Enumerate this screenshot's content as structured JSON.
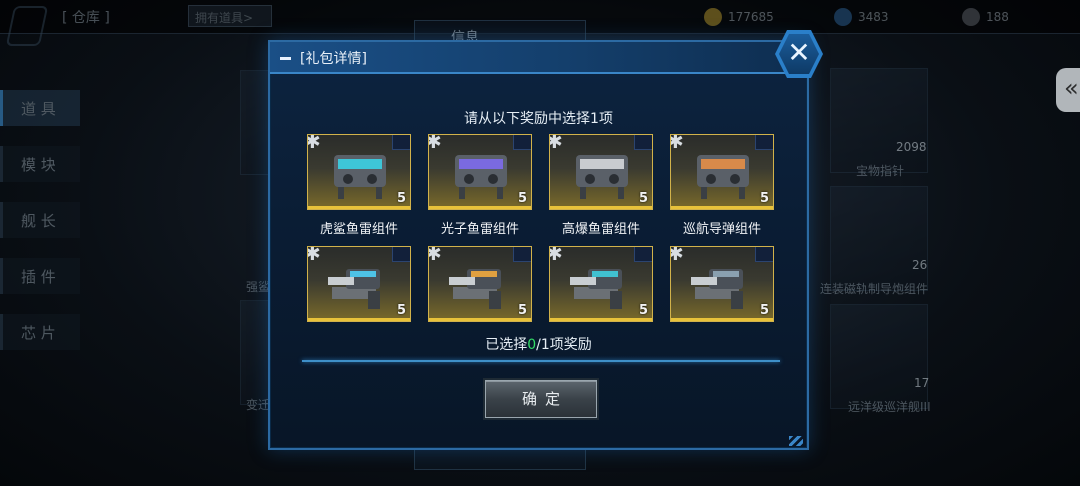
{
  "background": {
    "title": "[ 仓库 ]",
    "top_button": "拥有道具>",
    "resources": [
      {
        "value": "177685",
        "color": "#a58a2a"
      },
      {
        "value": "3483",
        "color": "#2a5a8a"
      },
      {
        "value": "188",
        "color": "#555a60"
      }
    ],
    "sidebar_tabs": [
      "道 具",
      "模 块",
      "舰 长",
      "插 件",
      "芯 片"
    ],
    "panel_title": "信息",
    "right_cards": [
      {
        "label": "宝物指针",
        "count": "2098"
      },
      {
        "label": "连装磁轨制导炮组件",
        "count": "26"
      },
      {
        "label": "远洋级巡洋舰III",
        "count": "17"
      }
    ],
    "left_card_label": "强鲨",
    "left_card_label2": "变迁"
  },
  "modal": {
    "title": "[礼包详情]",
    "instruction": "请从以下奖励中选择1项",
    "items": [
      {
        "label": "虎鲨鱼雷组件",
        "count": "5",
        "icon": "torpedo-launcher-icon",
        "accent": "#3ec6d8"
      },
      {
        "label": "光子鱼雷组件",
        "count": "5",
        "icon": "photon-torpedo-icon",
        "accent": "#7a6ae0"
      },
      {
        "label": "高爆鱼雷组件",
        "count": "5",
        "icon": "high-explosive-torpedo-icon",
        "accent": "#c9ccd0"
      },
      {
        "label": "巡航导弹组件",
        "count": "5",
        "icon": "cruise-missile-icon",
        "accent": "#d88a4a"
      },
      {
        "label": "",
        "count": "5",
        "icon": "turret-fragment-icon",
        "accent": "#4ec2e6"
      },
      {
        "label": "",
        "count": "5",
        "icon": "turret-fragment-icon",
        "accent": "#e0a040"
      },
      {
        "label": "",
        "count": "5",
        "icon": "turret-fragment-icon",
        "accent": "#40c0d0"
      },
      {
        "label": "",
        "count": "5",
        "icon": "turret-fragment-icon",
        "accent": "#8aa0b0"
      }
    ],
    "status_prefix": "已选择",
    "selected_count": "0",
    "status_suffix": "/1项奖励",
    "confirm_label": "确定"
  }
}
